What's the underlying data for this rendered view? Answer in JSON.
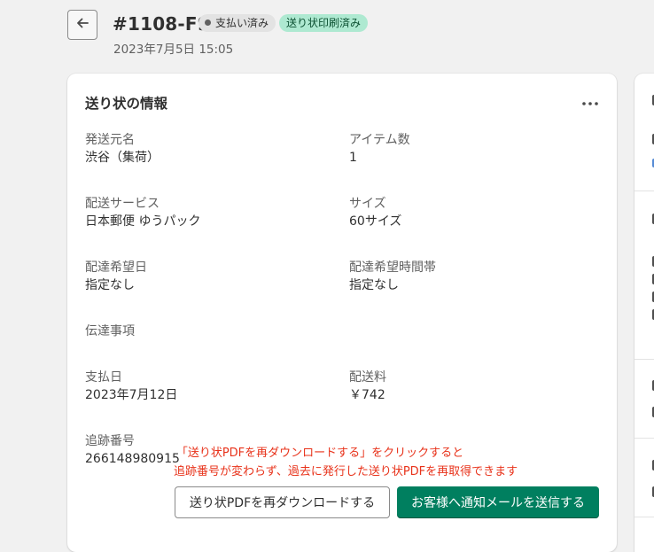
{
  "header": {
    "back_label": "戻る",
    "order_id": "#1108-F9",
    "badges": {
      "paid": "支払い済み",
      "printed": "送り状印刷済み"
    },
    "date": "2023年7月5日 15:05"
  },
  "card": {
    "title": "送り状の情報",
    "fields": {
      "origin": {
        "label": "発送元名",
        "value": "渋谷（集荷）"
      },
      "item_count": {
        "label": "アイテム数",
        "value": "1"
      },
      "service": {
        "label": "配送サービス",
        "value": "日本郵便 ゆうパック"
      },
      "size": {
        "label": "サイズ",
        "value": "60サイズ"
      },
      "delivery_date": {
        "label": "配達希望日",
        "value": "指定なし"
      },
      "delivery_time": {
        "label": "配達希望時間帯",
        "value": "指定なし"
      },
      "message": {
        "label": "伝達事項",
        "value": ""
      },
      "payment_date": {
        "label": "支払日",
        "value": "2023年7月12日"
      },
      "shipping_fee": {
        "label": "配送料",
        "value": "￥742"
      },
      "tracking": {
        "label": "追跡番号",
        "value": "266148980915"
      }
    },
    "buttons": {
      "redownload": "送り状PDFを再ダウンロードする",
      "notify": "お客様へ通知メールを送信する"
    }
  },
  "annotation": {
    "line1": "「送り状PDFを再ダウンロードする」をクリックすると",
    "line2": "追跡番号が変わらず、過去に発行した送り状PDFを再取得できます"
  },
  "icons": {
    "back": "arrow-left-icon",
    "more": "more-horizontal-icon"
  },
  "colors": {
    "primary_button": "#007f5f",
    "printed_badge_bg": "#aee9d1",
    "paid_badge_bg": "#e3e3e3",
    "annotation": "#e8321a"
  }
}
